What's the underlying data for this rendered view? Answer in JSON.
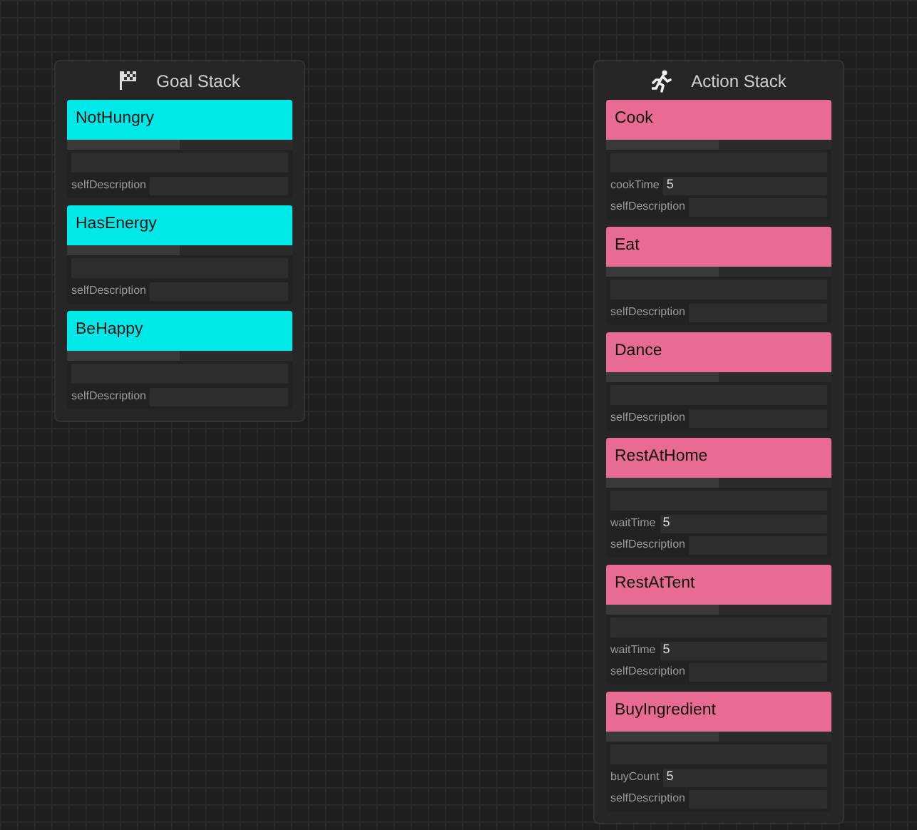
{
  "stacks": [
    {
      "title": "Goal Stack",
      "kind": "goal",
      "color": "#00e9e9",
      "nodes": [
        {
          "name": "NotHungry",
          "level": 0.5,
          "fields": [
            {
              "label": "selfDescription"
            }
          ]
        },
        {
          "name": "HasEnergy",
          "level": 0.5,
          "fields": [
            {
              "label": "selfDescription"
            }
          ]
        },
        {
          "name": "BeHappy",
          "level": 0.5,
          "fields": [
            {
              "label": "selfDescription"
            }
          ]
        }
      ]
    },
    {
      "title": "Action Stack",
      "kind": "action",
      "color": "#e86b91",
      "nodes": [
        {
          "name": "Cook",
          "level": 0.5,
          "fields": [
            {
              "label": "cookTime",
              "value": "5"
            },
            {
              "label": "selfDescription"
            }
          ]
        },
        {
          "name": "Eat",
          "level": 0.5,
          "fields": [
            {
              "label": "selfDescription"
            }
          ]
        },
        {
          "name": "Dance",
          "level": 0.5,
          "fields": [
            {
              "label": "selfDescription"
            }
          ]
        },
        {
          "name": "RestAtHome",
          "level": 0.5,
          "fields": [
            {
              "label": "waitTime",
              "value": "5"
            },
            {
              "label": "selfDescription"
            }
          ]
        },
        {
          "name": "RestAtTent",
          "level": 0.5,
          "fields": [
            {
              "label": "waitTime",
              "value": "5"
            },
            {
              "label": "selfDescription"
            }
          ]
        },
        {
          "name": "BuyIngredient",
          "level": 0.5,
          "fields": [
            {
              "label": "buyCount",
              "value": "5"
            },
            {
              "label": "selfDescription"
            }
          ]
        }
      ]
    }
  ]
}
